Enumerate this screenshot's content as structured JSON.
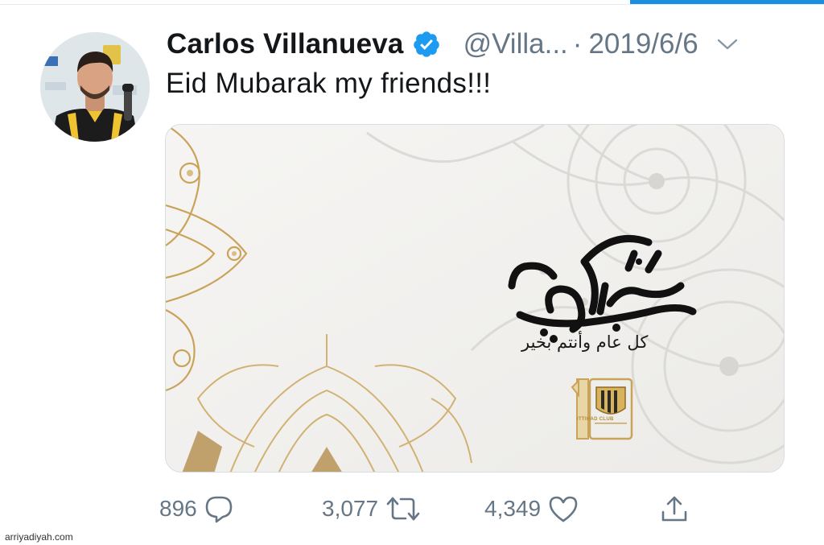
{
  "tweet": {
    "author_name": "Carlos Villanueva",
    "handle": "@Villa...",
    "separator": "·",
    "date": "2019/6/6",
    "text": "Eid Mubarak my friends!!!",
    "verified": true
  },
  "media": {
    "calligraphy_text": "عيد مبارك",
    "subtitle": "كل عام وأنتم بخير",
    "club_label": "ITTIHAD CLUB"
  },
  "actions": {
    "replies": "896",
    "retweets": "3,077",
    "likes": "4,349"
  },
  "watermark": "arriyadiyah.com",
  "colors": {
    "accent": "#1d8fe0",
    "verified": "#1d9bf0",
    "muted": "#657786",
    "gold": "#c9a35a"
  },
  "icons": [
    "verified-icon",
    "chevron-down-icon",
    "reply-icon",
    "retweet-icon",
    "like-icon",
    "share-icon"
  ]
}
